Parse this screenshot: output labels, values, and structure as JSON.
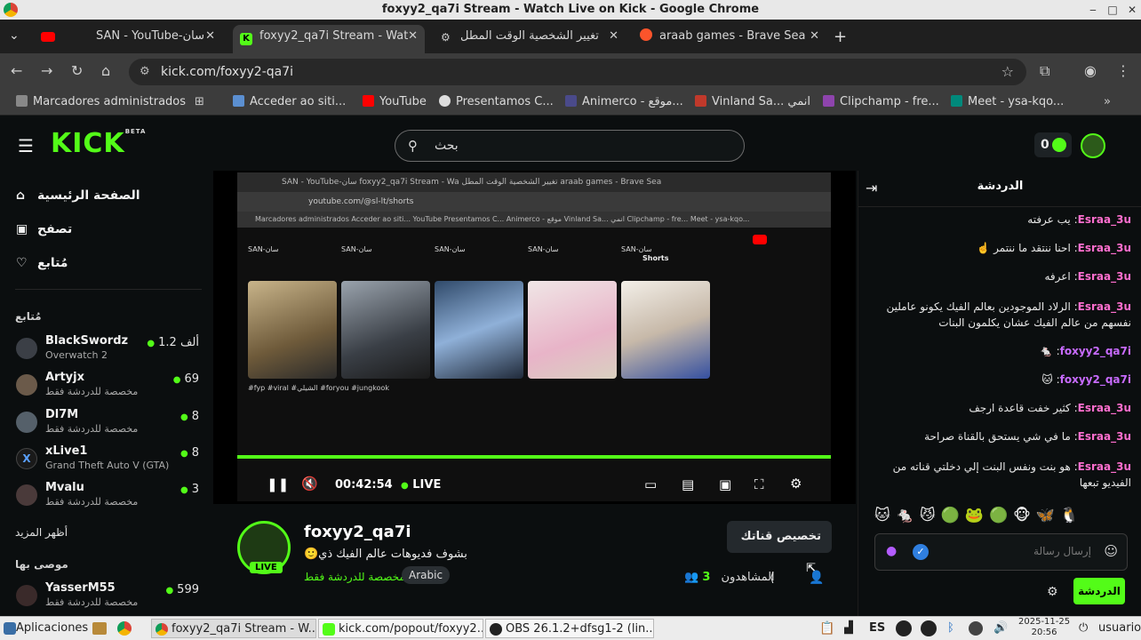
{
  "window": {
    "title": "foxyy2_qa7i Stream - Watch Live on Kick - Google Chrome"
  },
  "tabs": [
    {
      "label": "SAN - YouTube-سان"
    },
    {
      "label": "foxyy2_qa7i Stream - Wat",
      "active": true
    },
    {
      "label": "تغيير الشخصية الوقت المطل"
    },
    {
      "label": "araab games - Brave Sea"
    }
  ],
  "address": {
    "url": "kick.com/foxyy2-qa7i"
  },
  "bookmarks": [
    "Marcadores administrados",
    "Acceder ao siti...",
    "YouTube",
    "Presentamos C...",
    "Animerco - موقع...",
    "Vinland Sa... انمي",
    "Clipchamp - fre...",
    "Meet - ysa-kqo..."
  ],
  "kick": {
    "logo": "KICK",
    "logo_beta": "BETA",
    "search_placeholder": "بحث",
    "balance": "0",
    "nav": [
      {
        "icon": "home-icon",
        "label": "الصفحة الرئيسية"
      },
      {
        "icon": "browse-icon",
        "label": "تصفح"
      },
      {
        "icon": "heart-icon",
        "label": "مُتابع"
      }
    ],
    "following_heading": "مُتابع",
    "following": [
      {
        "name": "BlackSwordz",
        "sub": "Overwatch 2",
        "viewers": "1.2 ألف"
      },
      {
        "name": "Artyjx",
        "sub": "مخصصة للدردشة فقط",
        "viewers": "69"
      },
      {
        "name": "Dl7M",
        "sub": "مخصصة للدردشة فقط",
        "viewers": "8"
      },
      {
        "name": "xLive1",
        "sub": "Grand Theft Auto V (GTA)",
        "viewers": "8"
      },
      {
        "name": "Mvalu",
        "sub": "مخصصة للدردشة فقط",
        "viewers": "3"
      }
    ],
    "show_more": "أظهر المزيد",
    "recommended_heading": "موصى بها",
    "recommended": [
      {
        "name": "YasserM55",
        "sub": "مخصصة للدردشة فقط",
        "viewers": "599"
      }
    ]
  },
  "player": {
    "time": "00:42:54",
    "live_label": "LIVE",
    "inner_tabs": "SAN - YouTube-سان     foxyy2_qa7i Stream - Wa     تغيير الشخصية الوقت المطل     araab games - Brave Sea",
    "inner_url": "youtube.com/@sl-lt/shorts",
    "inner_bookmarks": "Marcadores administrados    Acceder ao siti...    YouTube    Presentamos C...    Animerco - موقع    Vinland Sa... انمي    Clipchamp - fre...    Meet - ysa-kqo...",
    "inner_shorts_tab": "Shorts",
    "inner_channel": "SAN-سان",
    "inner_hashtags": "#fyp #viral #الشيلي #foryou #jungkook"
  },
  "stream": {
    "streamer": "foxyy2_qa7i",
    "title": "بشوف فديوهات عالم الفيك ذي🙂",
    "category": "مخصصة للدردشة فقط",
    "language_tag": "Arabic",
    "customize_label": "تخصيص قناتك",
    "viewers_label": "المشاهدون",
    "viewers": "3",
    "live_badge": "LIVE"
  },
  "chat": {
    "title": "الدردشة",
    "messages": [
      {
        "user": "Esraa_3u",
        "text": "يب عرفته",
        "purple": false
      },
      {
        "user": "Esraa_3u",
        "text": "احنا ننتقد ما ننتمر ☝️",
        "purple": false
      },
      {
        "user": "Esraa_3u",
        "text": "اعرفه",
        "purple": false
      },
      {
        "user": "Esraa_3u",
        "text": "الرلاد الموجودين بعالم الفيك يكونو عاملين نفسهم من عالم الفيك عشان يكلمون البنات",
        "purple": false
      },
      {
        "user": "foxyy2_qa7i",
        "text": "🐁",
        "purple": true
      },
      {
        "user": "foxyy2_qa7i",
        "text": "🐱",
        "purple": true
      },
      {
        "user": "Esraa_3u",
        "text": "كثير خفت قاعدة ارجف",
        "purple": false
      },
      {
        "user": "Esraa_3u",
        "text": "ما في شي يستحق بالقناة صراحة",
        "purple": false
      },
      {
        "user": "Esraa_3u",
        "text": "هو بنت ونفس البنت إلي دخلتي قناته من الفيديو تبعها",
        "purple": false
      }
    ],
    "input_placeholder": "إرسال رسالة",
    "send_label": "الدردشة"
  },
  "taskbar": {
    "apps_label": "Aplicaciones",
    "items": [
      "foxyy2_qa7i Stream - W...",
      "kick.com/popout/foxyy2...",
      "OBS 26.1.2+dfsg1-2 (lin..."
    ],
    "lang": "ES",
    "date": "2025-11-25",
    "time": "20:56",
    "user": "usuario"
  }
}
